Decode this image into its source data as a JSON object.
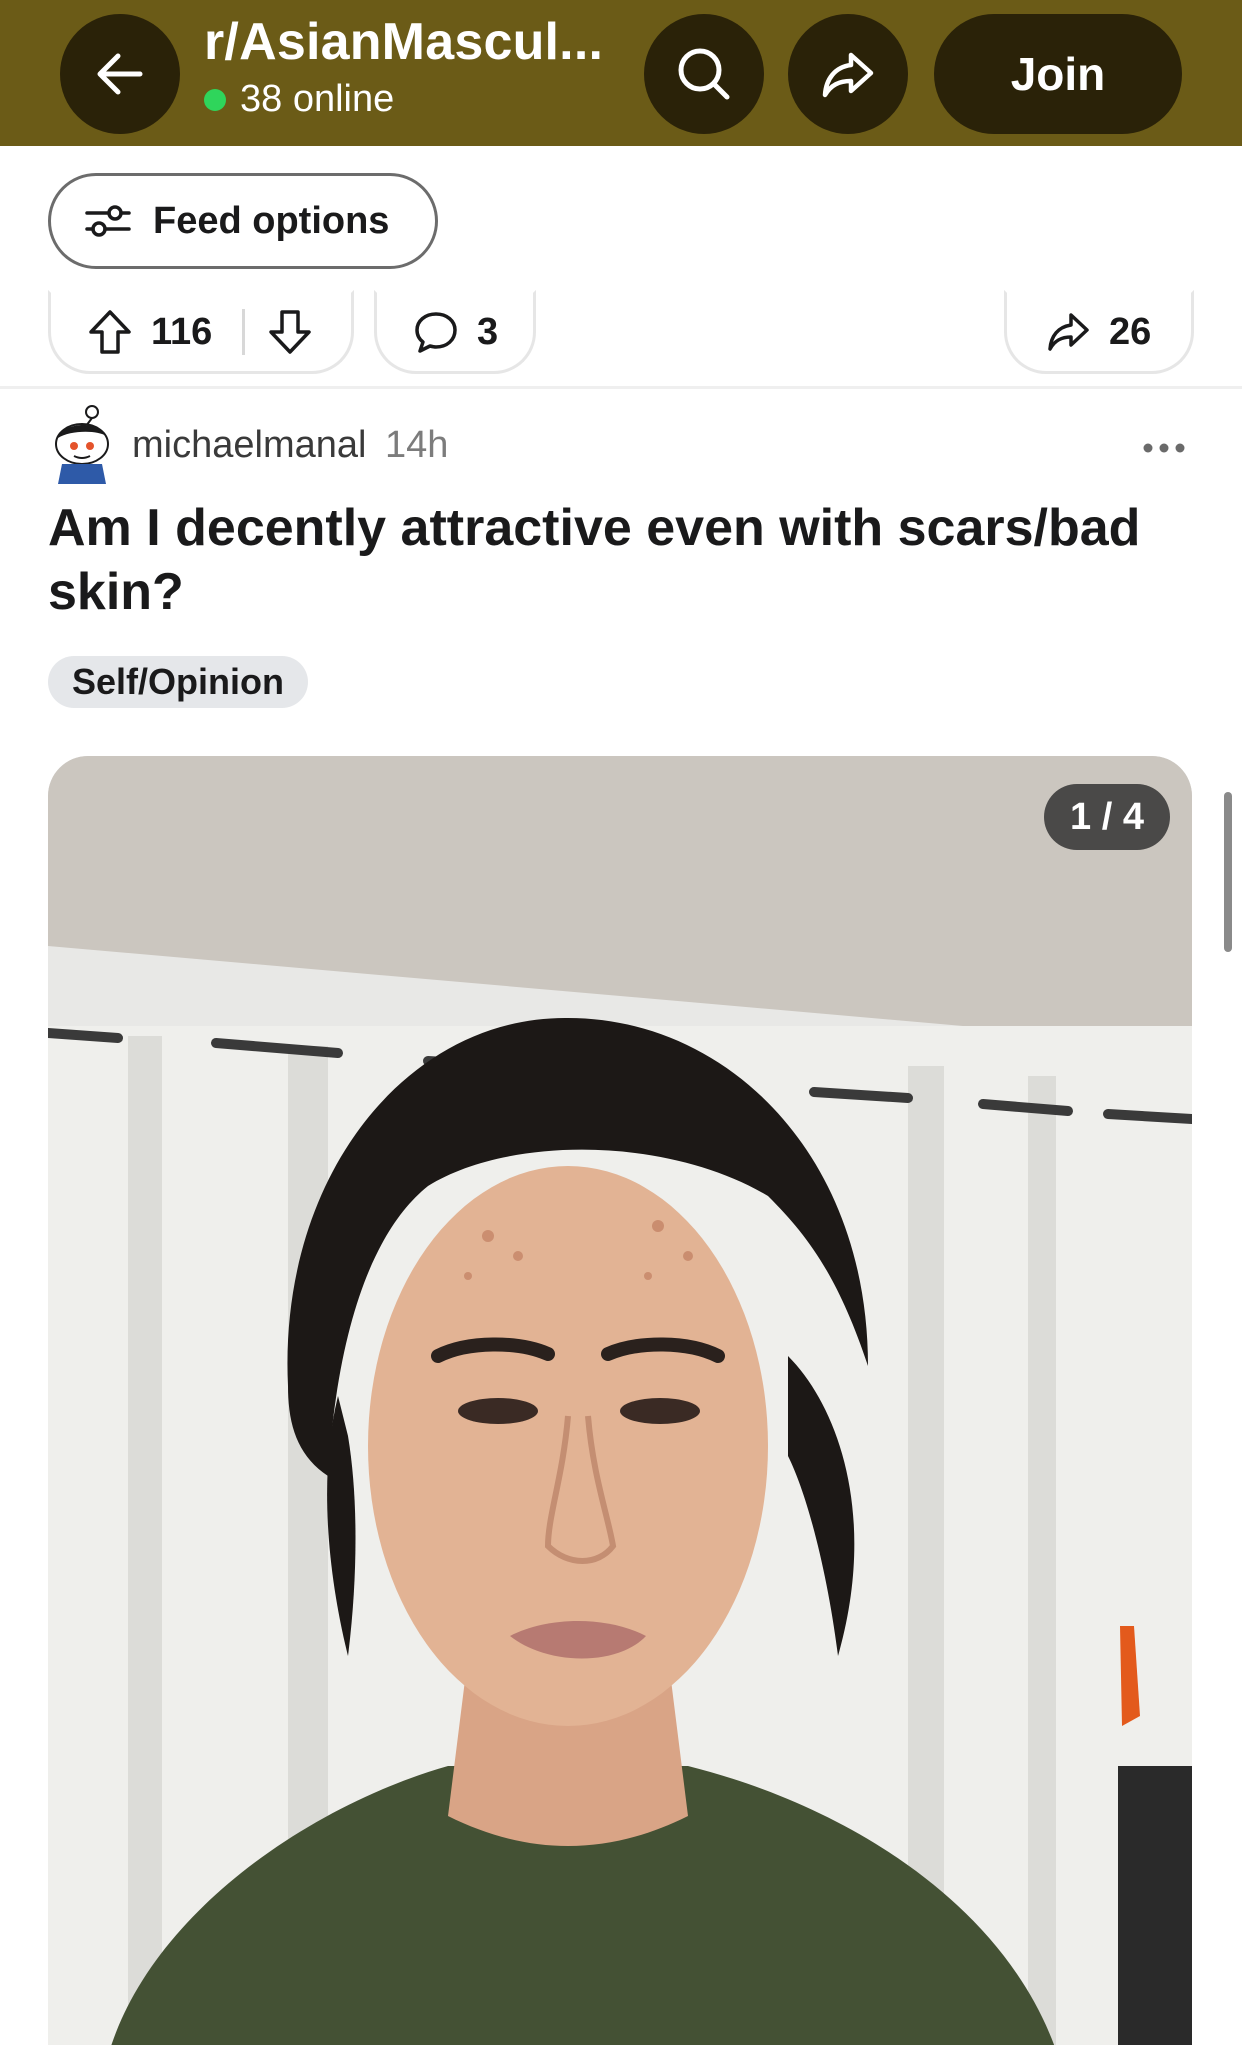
{
  "header": {
    "subreddit": "r/AsianMascul...",
    "online_count": "38 online",
    "join_label": "Join",
    "background_color": "#6b5b17",
    "icons": [
      "back-arrow-icon",
      "search-icon",
      "share-icon"
    ]
  },
  "feed_options": {
    "label": "Feed options",
    "icon": "sliders-icon"
  },
  "previous_post_actions": {
    "upvotes": "116",
    "comments": "3",
    "shares": "26"
  },
  "post": {
    "author": "michaelmanal",
    "age": "14h",
    "title": "Am I decently attractive even with scars/bad skin?",
    "flair": "Self/Opinion",
    "gallery_counter": "1 / 4"
  }
}
